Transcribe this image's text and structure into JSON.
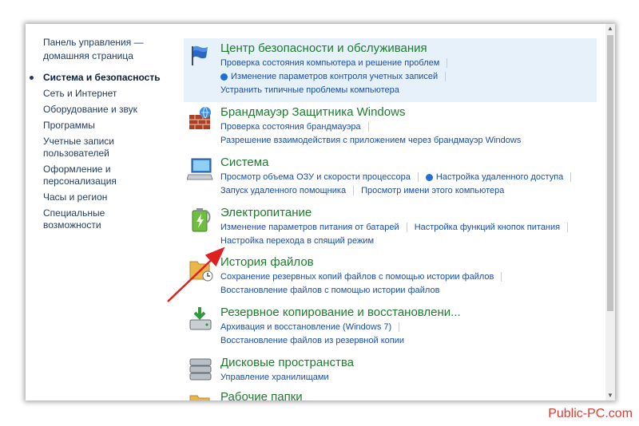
{
  "nav": {
    "home": "Панель управления — домашняя страница",
    "items": [
      {
        "label": "Система и безопасность",
        "active": true
      },
      {
        "label": "Сеть и Интернет"
      },
      {
        "label": "Оборудование и звук"
      },
      {
        "label": "Программы"
      },
      {
        "label": "Учетные записи пользователей"
      },
      {
        "label": "Оформление и персонализация"
      },
      {
        "label": "Часы и регион"
      },
      {
        "label": "Специальные возможности"
      }
    ]
  },
  "categories": [
    {
      "title": "Центр безопасности и обслуживания",
      "icon": "flag-icon",
      "links": [
        [
          "Проверка состояния компьютера и решение проблем"
        ],
        [
          "Изменение параметров контроля учетных записей"
        ],
        [
          "Устранить типичные проблемы компьютера"
        ]
      ]
    },
    {
      "title": "Брандмауэр Защитника Windows",
      "icon": "firewall-icon",
      "links": [
        [
          "Проверка состояния брандмауэра"
        ],
        [
          "Разрешение взаимодействия с приложением через брандмауэр Windows"
        ]
      ]
    },
    {
      "title": "Система",
      "icon": "computer-icon",
      "links": [
        [
          "Просмотр объема ОЗУ и скорости процессора",
          "Настройка удаленного доступа"
        ],
        [
          "Запуск удаленного помощника",
          "Просмотр имени этого компьютера"
        ]
      ]
    },
    {
      "title": "Электропитание",
      "icon": "battery-icon",
      "links": [
        [
          "Изменение параметров питания от батарей",
          "Настройка функций кнопок питания"
        ],
        [
          "Настройка перехода в спящий режим"
        ]
      ]
    },
    {
      "title": "История файлов",
      "icon": "folder-clock-icon",
      "links": [
        [
          "Сохранение резервных копий файлов с помощью истории файлов"
        ],
        [
          "Восстановление файлов с помощью истории файлов"
        ]
      ]
    },
    {
      "title": "Резервное копирование и восстановлени...",
      "icon": "backup-icon",
      "links": [
        [
          "Архивация и восстановление (Windows 7)"
        ],
        [
          "Восстановление файлов из резервной копии"
        ]
      ]
    },
    {
      "title": "Дисковые пространства",
      "icon": "disks-icon",
      "links": [
        [
          "Управление хранилищами"
        ]
      ]
    },
    {
      "title": "Рабочие папки",
      "icon": "folder-icon",
      "links": []
    }
  ],
  "watermark": "Public-PC.com",
  "colors": {
    "title": "#1e7b2d",
    "link": "#1a4ea8",
    "highlight": "#e6f1fa",
    "arrow": "#e02020"
  }
}
